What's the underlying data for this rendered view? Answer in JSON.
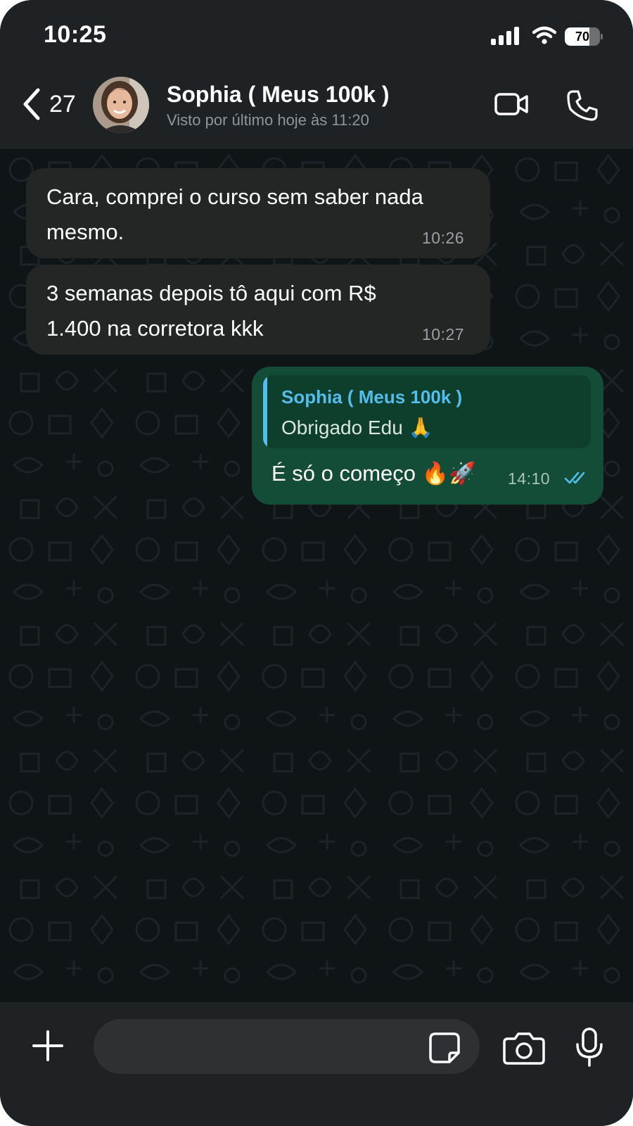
{
  "status_bar": {
    "time": "10:25",
    "battery": "70",
    "battery_level": 0.7
  },
  "header": {
    "back_count": "27",
    "contact_name": "Sophia ( Meus 100k )",
    "last_seen": "Visto por último hoje às 11:20",
    "icons": [
      "chevron-left-icon",
      "video-camera-icon",
      "phone-icon"
    ]
  },
  "messages": [
    {
      "direction": "incoming",
      "lines": [
        "Cara, comprei o curso sem saber nada",
        "mesmo."
      ],
      "time": "10:26"
    },
    {
      "direction": "incoming",
      "lines": [
        "3 semanas depois tô aqui com R$",
        "1.400 na corretora kkk"
      ],
      "time": "10:27"
    },
    {
      "direction": "outgoing",
      "quote": {
        "author": "Sophia ( Meus 100k )",
        "text": "Obrigado Edu 🙏"
      },
      "text": "É só o começo 🔥🚀",
      "time": "14:10",
      "status": "read"
    }
  ],
  "composer": {
    "placeholder": "",
    "icons": [
      "plus-icon",
      "sticker-icon",
      "camera-icon",
      "microphone-icon"
    ]
  },
  "colors": {
    "header_bg": "#1f2225",
    "chat_bg": "#0f1417",
    "incoming_bubble": "#242626",
    "outgoing_bubble": "#134d37",
    "quote_accent": "#53bdeb",
    "read_ticks": "#53bdeb"
  }
}
